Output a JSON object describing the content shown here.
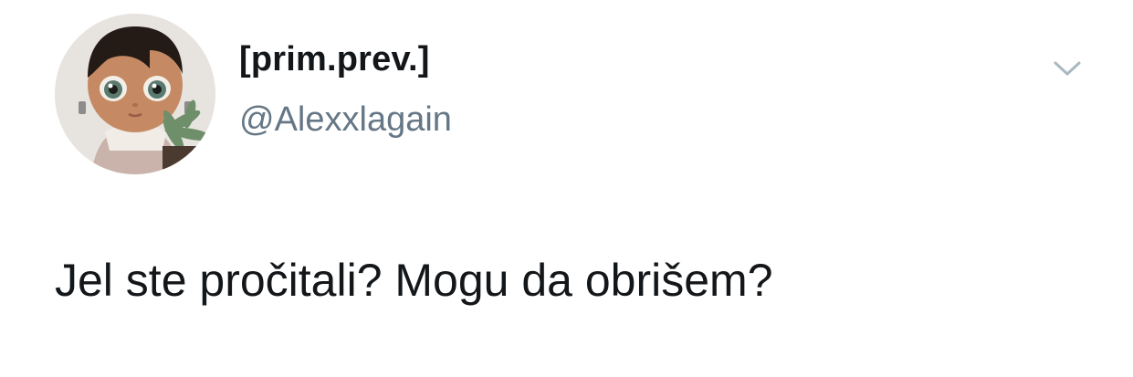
{
  "tweet": {
    "display_name": "[prim.prev.]",
    "handle": "@Alexxlagain",
    "text": "Jel ste pročitali? Mogu da obrišem?"
  },
  "icons": {
    "menu": "chevron-down-icon",
    "avatar": "avatar"
  },
  "colors": {
    "text_primary": "#14171a",
    "text_secondary": "#657786",
    "chevron": "#aab8c2",
    "background": "#ffffff"
  }
}
